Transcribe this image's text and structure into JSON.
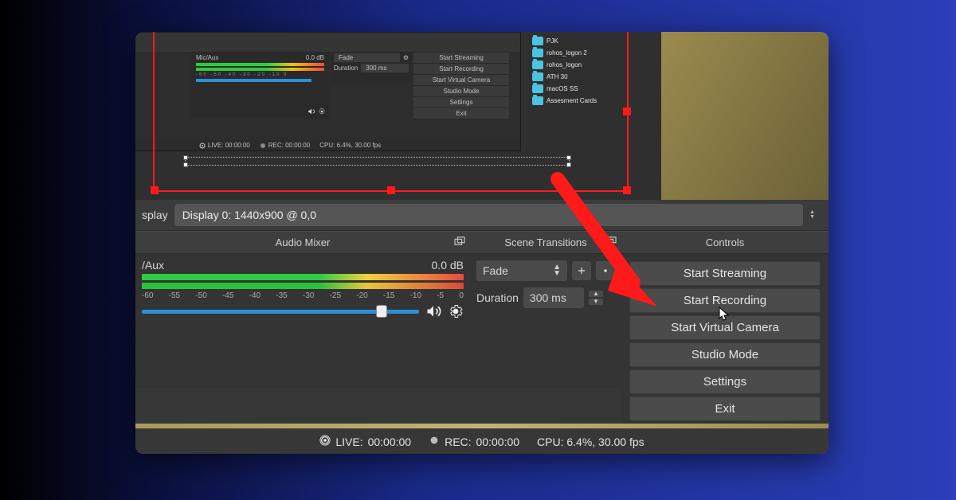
{
  "display_row": {
    "label_partial": "splay",
    "selected": "Display 0: 1440x900 @ 0,0"
  },
  "docks": {
    "mixer_title": "Audio Mixer",
    "transitions_title": "Scene Transitions",
    "controls_title": "Controls"
  },
  "mixer": {
    "channel_partial": "/Aux",
    "db": "0.0 dB",
    "scale": [
      "-60",
      "-55",
      "-50",
      "-45",
      "-40",
      "-35",
      "-30",
      "-25",
      "-20",
      "-15",
      "-10",
      "-5",
      "0"
    ]
  },
  "transitions": {
    "type": "Fade",
    "duration_label": "Duration",
    "duration_value": "300 ms"
  },
  "controls": {
    "start_streaming": "Start Streaming",
    "start_recording": "Start Recording",
    "start_virtual_camera": "Start Virtual Camera",
    "studio_mode": "Studio Mode",
    "settings": "Settings",
    "exit": "Exit"
  },
  "status": {
    "live_label": "LIVE:",
    "live_time": "00:00:00",
    "rec_label": "REC:",
    "rec_time": "00:00:00",
    "cpu": "CPU: 6.4%, 30.00 fps"
  },
  "mini": {
    "channel": "Mic/Aux",
    "db": "0.0 dB",
    "trans_type": "Fade",
    "trans_dur_label": "Duration",
    "trans_dur_val": "300 ms",
    "controls": {
      "start_streaming": "Start Streaming",
      "start_recording": "Start Recording",
      "start_virtual_camera": "Start Virtual Camera",
      "studio_mode": "Studio Mode",
      "settings": "Settings",
      "exit": "Exit"
    },
    "status": {
      "live": "LIVE: 00:00:00",
      "rec": "REC: 00:00:00",
      "cpu": "CPU: 6.4%, 30.00 fps"
    }
  },
  "desktop_folders": [
    "PJK",
    "rohos_logon 2",
    "rohos_logon",
    "ATH 30",
    "macOS SS",
    "Assesment Cards"
  ],
  "colors": {
    "red": "#ff1a1a",
    "panel": "#373737",
    "accent_blue": "#2a90d8"
  }
}
